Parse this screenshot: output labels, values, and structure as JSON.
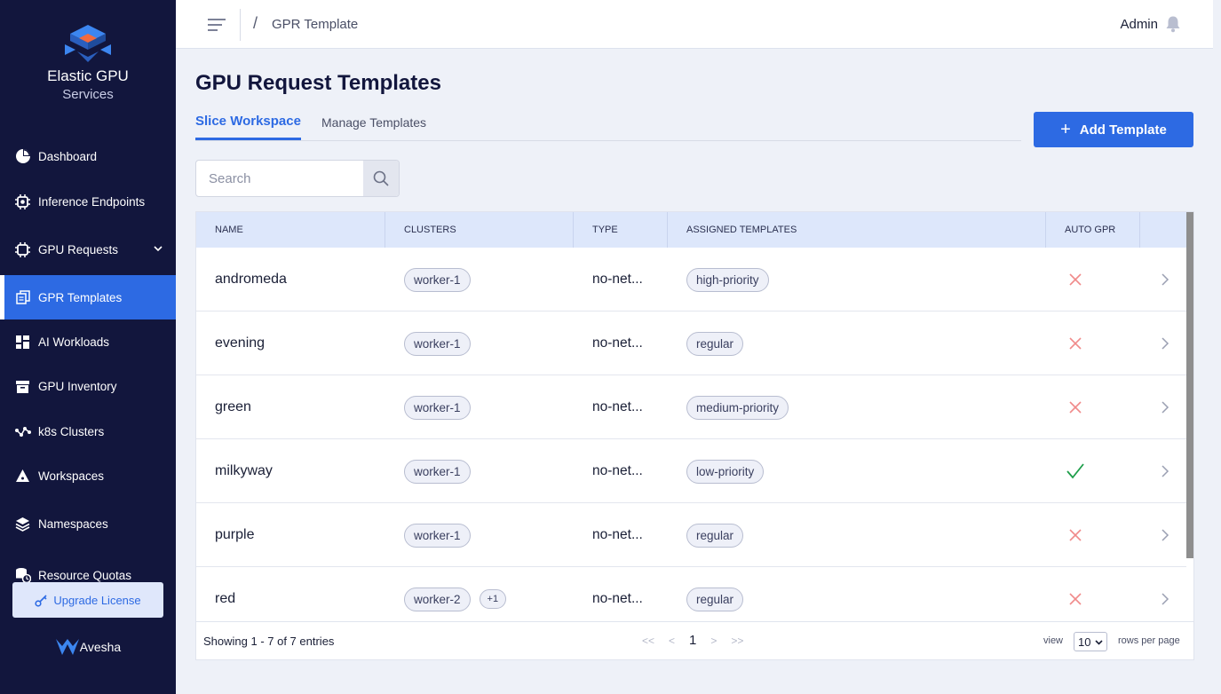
{
  "app": {
    "name_line1": "Elastic GPU",
    "name_line2": "Services",
    "vendor": "Avesha"
  },
  "sidebar": {
    "items": [
      {
        "label": "Dashboard",
        "icon": "pie-chart-icon"
      },
      {
        "label": "Inference Endpoints",
        "icon": "chip-gear-icon"
      },
      {
        "label": "GPU Requests",
        "icon": "chip-icon"
      },
      {
        "label": "GPR Templates",
        "icon": "copy-icon"
      },
      {
        "label": "AI Workloads",
        "icon": "grid-icon"
      },
      {
        "label": "GPU Inventory",
        "icon": "archive-icon"
      },
      {
        "label": "k8s Clusters",
        "icon": "network-icon"
      },
      {
        "label": "Workspaces",
        "icon": "pyramid-icon"
      },
      {
        "label": "Namespaces",
        "icon": "layers-icon"
      },
      {
        "label": "Resource Quotas",
        "icon": "database-clock-icon"
      }
    ],
    "active_index": 3,
    "upgrade_label": "Upgrade License"
  },
  "topbar": {
    "breadcrumb": "GPR Template",
    "user": "Admin"
  },
  "main": {
    "title": "GPU Request Templates",
    "tabs": [
      {
        "label": "Slice Workspace",
        "active": true
      },
      {
        "label": "Manage Templates",
        "active": false
      }
    ],
    "add_button_label": "Add Template",
    "search_placeholder": "Search"
  },
  "table": {
    "columns": [
      "NAME",
      "CLUSTERS",
      "TYPE",
      "ASSIGNED TEMPLATES",
      "AUTO GPR"
    ],
    "rows": [
      {
        "name": "andromeda",
        "clusters": [
          "worker-1"
        ],
        "extra": "",
        "type": "no-net...",
        "template": "high-priority",
        "auto_gpr": false
      },
      {
        "name": "evening",
        "clusters": [
          "worker-1"
        ],
        "extra": "",
        "type": "no-net...",
        "template": "regular",
        "auto_gpr": false
      },
      {
        "name": "green",
        "clusters": [
          "worker-1"
        ],
        "extra": "",
        "type": "no-net...",
        "template": "medium-priority",
        "auto_gpr": false
      },
      {
        "name": "milkyway",
        "clusters": [
          "worker-1"
        ],
        "extra": "",
        "type": "no-net...",
        "template": "low-priority",
        "auto_gpr": true
      },
      {
        "name": "purple",
        "clusters": [
          "worker-1"
        ],
        "extra": "",
        "type": "no-net...",
        "template": "regular",
        "auto_gpr": false
      },
      {
        "name": "red",
        "clusters": [
          "worker-2"
        ],
        "extra": "+1",
        "type": "no-net...",
        "template": "regular",
        "auto_gpr": false
      }
    ],
    "footer": {
      "showing": "Showing 1 - 7 of 7 entries",
      "first": "<<",
      "prev": "<",
      "page": "1",
      "next": ">",
      "last": ">>",
      "view_label": "view",
      "rows_per_page": "10",
      "rows_per_page_label": "rows per page"
    }
  },
  "colors": {
    "sidebar_bg": "#12163d",
    "accent": "#2d6ae3",
    "header_row": "#dde7fb",
    "cross": "#f08a8a",
    "check": "#1e9e4a"
  }
}
